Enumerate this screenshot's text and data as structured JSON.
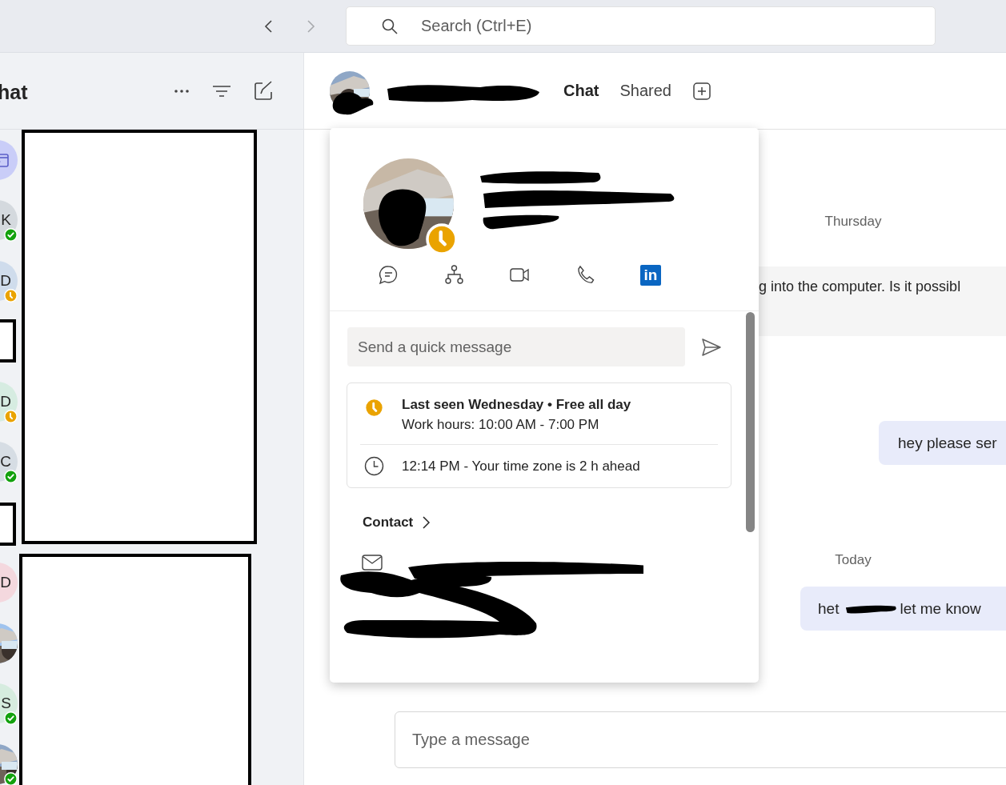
{
  "top_bar": {
    "search": {
      "placeholder": "Search (Ctrl+E)"
    }
  },
  "sidebar": {
    "title": "hat",
    "chats": [
      {
        "avatar": {
          "kind": "icon",
          "color": "#c9cdf8"
        }
      },
      {
        "avatar": {
          "kind": "initial",
          "initial": "K",
          "color": "#d4d9de"
        },
        "status": {
          "color": "#13a10e",
          "away": false
        }
      },
      {
        "avatar": {
          "kind": "initial",
          "initial": "D",
          "color": "#cfdcec"
        },
        "status": {
          "color": "#eaa300",
          "away": true
        }
      },
      {
        "avatar": {
          "kind": "covered"
        }
      },
      {
        "avatar": {
          "kind": "initial",
          "initial": "D",
          "color": "#d6ece1"
        },
        "status": {
          "color": "#eaa300",
          "away": true
        }
      },
      {
        "avatar": {
          "kind": "initial",
          "initial": "C",
          "color": "#d6dde4"
        },
        "status": {
          "color": "#13a10e",
          "away": false
        }
      },
      {
        "avatar": {
          "kind": "covered"
        }
      },
      {
        "avatar": {
          "kind": "initial",
          "initial": "D",
          "color": "#f4d8de"
        }
      },
      {
        "avatar": {
          "kind": "picture"
        }
      },
      {
        "avatar": {
          "kind": "initial",
          "initial": "S",
          "color": "#d6ecdf"
        },
        "status": {
          "color": "#13a10e",
          "away": false
        }
      },
      {
        "avatar": {
          "kind": "picture"
        },
        "status": {
          "color": "#13a10e",
          "away": false
        }
      }
    ]
  },
  "chat_header": {
    "tabs": [
      {
        "label": "Chat",
        "selected": true
      },
      {
        "label": "Shared",
        "selected": false
      }
    ]
  },
  "profile_card": {
    "status": {
      "color": "#eaa300",
      "away": true
    },
    "linkedin_badge": "in",
    "quick_message": {
      "placeholder": "Send a quick message"
    },
    "availability": {
      "title": "Last seen Wednesday • Free all day",
      "hours": "Work hours: 10:00 AM - 7:00 PM",
      "local_time": "12:14 PM - Your time zone is 2 h ahead"
    },
    "contact_heading": "Contact"
  },
  "messages": [
    {
      "kind": "date",
      "text": "Thursday"
    },
    {
      "kind": "incoming",
      "text": "g into the computer. Is it possibl"
    },
    {
      "kind": "outgoing",
      "text": "hey please ser"
    },
    {
      "kind": "date",
      "text": "Today"
    },
    {
      "kind": "outgoing_redacted",
      "text": "het",
      "text_after": "let me know"
    }
  ],
  "compose": {
    "placeholder": "Type a message"
  }
}
